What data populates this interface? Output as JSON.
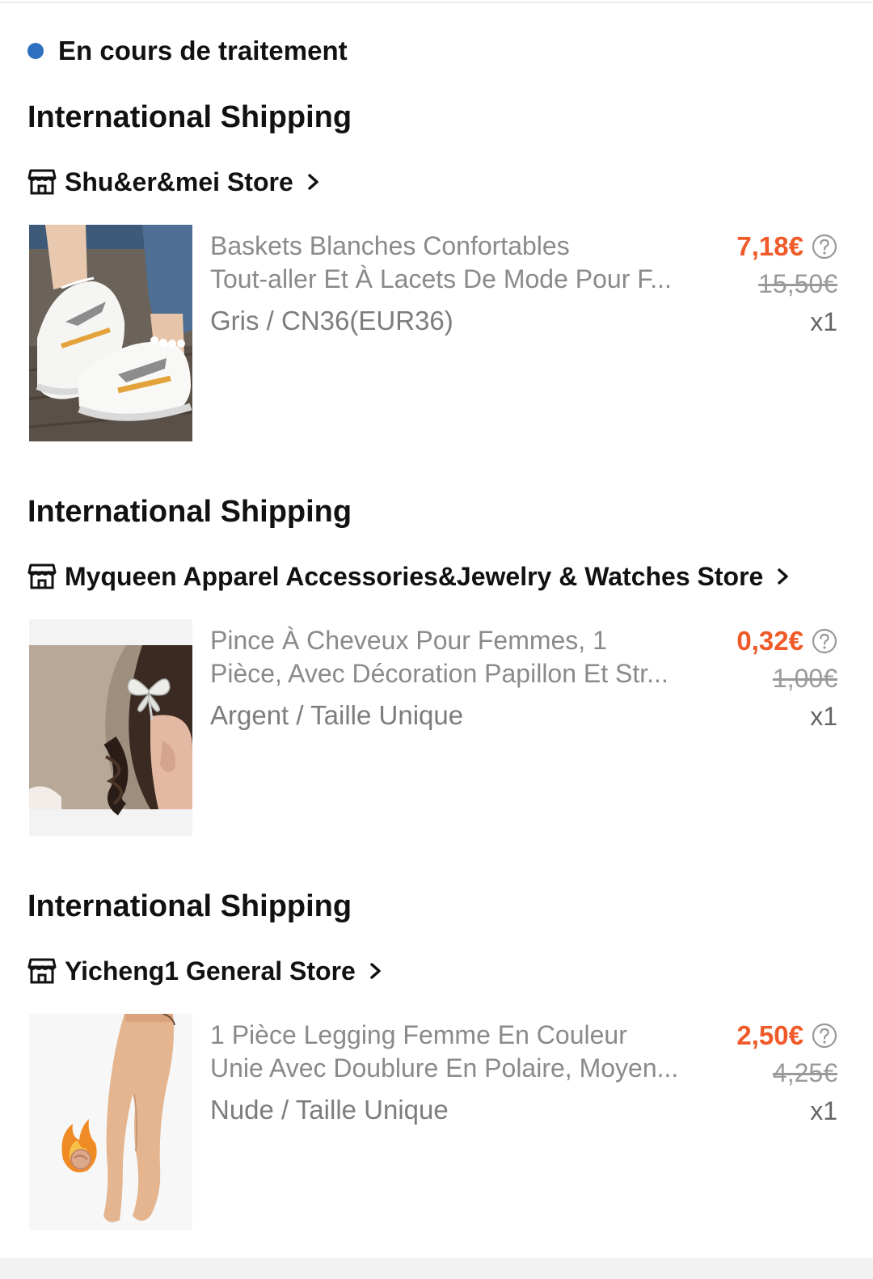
{
  "status": {
    "label": "En cours de traitement",
    "color": "#2f6fbf"
  },
  "groups": [
    {
      "shipping_title": "International Shipping",
      "store_name": "Shu&er&mei Store",
      "item": {
        "title_line1": "Baskets Blanches Confortables",
        "title_line2": "Tout-aller Et À Lacets De Mode Pour F...",
        "variant": "Gris / CN36(EUR36)",
        "price": "7,18€",
        "original_price": "15,50€",
        "quantity": "x1",
        "image_icon": "sneakers-image"
      }
    },
    {
      "shipping_title": "International Shipping",
      "store_name": "Myqueen Apparel Accessories&Jewelry & Watches Store",
      "item": {
        "title_line1": "Pince À Cheveux Pour Femmes, 1",
        "title_line2": "Pièce, Avec Décoration Papillon Et Str...",
        "variant": "Argent / Taille Unique",
        "price": "0,32€",
        "original_price": "1,00€",
        "quantity": "x1",
        "image_icon": "hair-clip-image"
      }
    },
    {
      "shipping_title": "International Shipping",
      "store_name": "Yicheng1 General Store",
      "item": {
        "title_line1": "1 Pièce Legging Femme En Couleur",
        "title_line2": "Unie Avec Doublure En Polaire, Moyen...",
        "variant": "Nude / Taille Unique",
        "price": "2,50€",
        "original_price": "4,25€",
        "quantity": "x1",
        "image_icon": "leggings-image"
      }
    }
  ],
  "colors": {
    "price": "#f05a28",
    "muted_text": "#8a8a8a",
    "heading": "#111111"
  }
}
